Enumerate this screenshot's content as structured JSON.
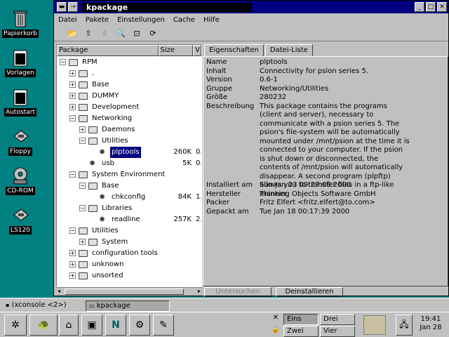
{
  "desktop": {
    "icons": [
      {
        "label": "Papierkorb",
        "icon": "trash-icon"
      },
      {
        "label": "Vorlagen",
        "icon": "folder-icon"
      },
      {
        "label": "Autostart",
        "icon": "folder-icon"
      },
      {
        "label": "Floppy",
        "icon": "floppy-icon"
      },
      {
        "label": "CD-ROM",
        "icon": "cdrom-icon"
      },
      {
        "label": "LS120",
        "icon": "drive-icon"
      }
    ]
  },
  "window": {
    "title": "kpackage",
    "menu": [
      "Datei",
      "Pakete",
      "Einstellungen",
      "Cache",
      "Hilfe"
    ],
    "tree_headers": [
      "Package",
      "Size",
      "V"
    ],
    "tree": [
      {
        "label": "RPM",
        "level": 0,
        "exp": "−"
      },
      {
        "label": ".",
        "level": 1,
        "exp": "+"
      },
      {
        "label": "Base",
        "level": 1,
        "exp": "+"
      },
      {
        "label": "DUMMY",
        "level": 1,
        "exp": "+"
      },
      {
        "label": "Development",
        "level": 1,
        "exp": "+"
      },
      {
        "label": "Networking",
        "level": 1,
        "exp": "−"
      },
      {
        "label": "Daemons",
        "level": 2,
        "exp": "+"
      },
      {
        "label": "Utilities",
        "level": 2,
        "exp": "−"
      },
      {
        "label": "plptools",
        "level": 3,
        "pkg": true,
        "size": "260K",
        "ver": "0.",
        "selected": true
      },
      {
        "label": "usb",
        "level": 2,
        "pkg": true,
        "size": "5K",
        "ver": "0."
      },
      {
        "label": "System Environment",
        "level": 1,
        "exp": "−"
      },
      {
        "label": "Base",
        "level": 2,
        "exp": "−"
      },
      {
        "label": "chkconfig",
        "level": 3,
        "pkg": true,
        "size": "84K",
        "ver": "1."
      },
      {
        "label": "Libraries",
        "level": 2,
        "exp": "−"
      },
      {
        "label": "readline",
        "level": 3,
        "pkg": true,
        "size": "257K",
        "ver": "2."
      },
      {
        "label": "Utilities",
        "level": 1,
        "exp": "−"
      },
      {
        "label": "System",
        "level": 2,
        "exp": "+"
      },
      {
        "label": "configuration tools",
        "level": 1,
        "exp": "+"
      },
      {
        "label": "unknown",
        "level": 1,
        "exp": "+"
      },
      {
        "label": "unsorted",
        "level": 1,
        "exp": "+"
      }
    ],
    "tabs": [
      "Eigenschaften",
      "Datei-Liste"
    ],
    "props": [
      {
        "key": "Name",
        "val": "plptools",
        "lines": 1
      },
      {
        "key": "Inhalt",
        "val": "Connectivity for psion series 5.",
        "lines": 1
      },
      {
        "key": "Version",
        "val": "0.6-1",
        "lines": 1
      },
      {
        "key": "Gruppe",
        "val": "Networking/Utilities",
        "lines": 1
      },
      {
        "key": "Größe",
        "val": "280232",
        "lines": 1
      },
      {
        "key": "Beschreibung",
        "val": "This package contains the programs (client and server), necessary to communicate with a psion series 5. The psion's file-system will be automatically mounted under /mnt/psion at the time it is connected to your computer. If the psion is shut down or disconnected, the contents of /mnt/psion will automatically disappear. A second program (plpftp) allows you to transfer files in a ftp-like manner.",
        "lines": 9
      },
      {
        "key": "Installiert am",
        "val": "Sun Jan 23 09:27:08 2000",
        "lines": 1
      },
      {
        "key": "Hersteller",
        "val": "Thinking Objects Software GmbH",
        "lines": 1
      },
      {
        "key": "Packer",
        "val": "Fritz Elfert <fritz.elfert@to.com>",
        "lines": 1
      },
      {
        "key": "Gepackt am",
        "val": "Tue Jan 18 00:17:39 2000",
        "lines": 1
      }
    ],
    "buttons": {
      "uninstall_disabled": "Untersuchen",
      "uninstall": "Deinstallieren"
    }
  },
  "taskbar": {
    "tasks": [
      "(xconsole <2>)",
      "kpackage"
    ],
    "desktops": [
      "Eins",
      "Drei",
      "Zwei",
      "Vier"
    ],
    "clock": {
      "time": "19:41",
      "date": "Jan 28"
    }
  }
}
